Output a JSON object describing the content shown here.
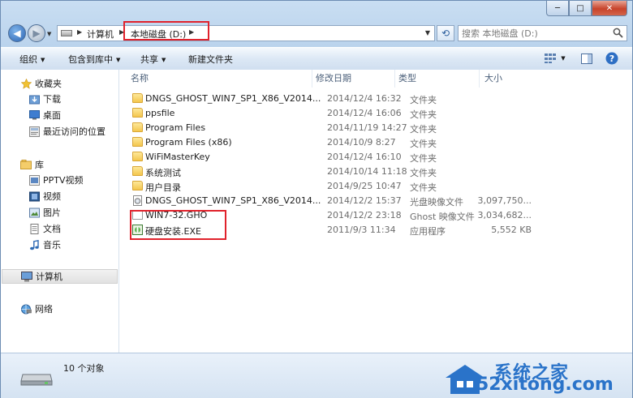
{
  "window": {
    "controls": {
      "minimize": "─",
      "maximize": "□",
      "close": "✕"
    }
  },
  "address": {
    "crumbs": [
      "计算机",
      "本地磁盘 (D:)"
    ],
    "search_placeholder": "搜索 本地磁盘 (D:)"
  },
  "toolbar": {
    "organize": "组织",
    "include_library": "包含到库中",
    "share": "共享",
    "new_folder": "新建文件夹"
  },
  "sidebar": {
    "favorites": {
      "label": "收藏夹",
      "items": [
        "下载",
        "桌面",
        "最近访问的位置"
      ]
    },
    "libraries": {
      "label": "库",
      "items": [
        "PPTV视频",
        "视频",
        "图片",
        "文档",
        "音乐"
      ]
    },
    "computer": "计算机",
    "network": "网络"
  },
  "columns": {
    "name": "名称",
    "date": "修改日期",
    "type": "类型",
    "size": "大小"
  },
  "files": [
    {
      "name": "DNGS_GHOST_WIN7_SP1_X86_V2014...",
      "date": "2014/12/4 16:32",
      "type": "文件夹",
      "size": "",
      "icon": "folder-icon"
    },
    {
      "name": "ppsfile",
      "date": "2014/12/4 16:06",
      "type": "文件夹",
      "size": "",
      "icon": "folder-icon"
    },
    {
      "name": "Program Files",
      "date": "2014/11/19 14:27",
      "type": "文件夹",
      "size": "",
      "icon": "folder-icon"
    },
    {
      "name": "Program Files (x86)",
      "date": "2014/10/9 8:27",
      "type": "文件夹",
      "size": "",
      "icon": "folder-icon"
    },
    {
      "name": "WiFiMasterKey",
      "date": "2014/12/4 16:10",
      "type": "文件夹",
      "size": "",
      "icon": "folder-icon"
    },
    {
      "name": "系统测试",
      "date": "2014/10/14 11:18",
      "type": "文件夹",
      "size": "",
      "icon": "folder-icon"
    },
    {
      "name": "用户目录",
      "date": "2014/9/25 10:47",
      "type": "文件夹",
      "size": "",
      "icon": "folder-icon"
    },
    {
      "name": "DNGS_GHOST_WIN7_SP1_X86_V2014...",
      "date": "2014/12/2 15:37",
      "type": "光盘映像文件",
      "size": "3,097,750...",
      "icon": "disc-image-icon"
    },
    {
      "name": "WIN7-32.GHO",
      "date": "2014/12/2 23:18",
      "type": "Ghost 映像文件",
      "size": "3,034,682...",
      "icon": "file-icon"
    },
    {
      "name": "硬盘安装.EXE",
      "date": "2011/9/3 11:34",
      "type": "应用程序",
      "size": "5,552 KB",
      "icon": "exe-icon"
    }
  ],
  "status": {
    "count": "10 个对象"
  },
  "watermark": {
    "title": "系统之家",
    "url": "52xitong.com"
  },
  "colors": {
    "highlight_box": "#e0222c",
    "accent": "#2a73c9"
  }
}
